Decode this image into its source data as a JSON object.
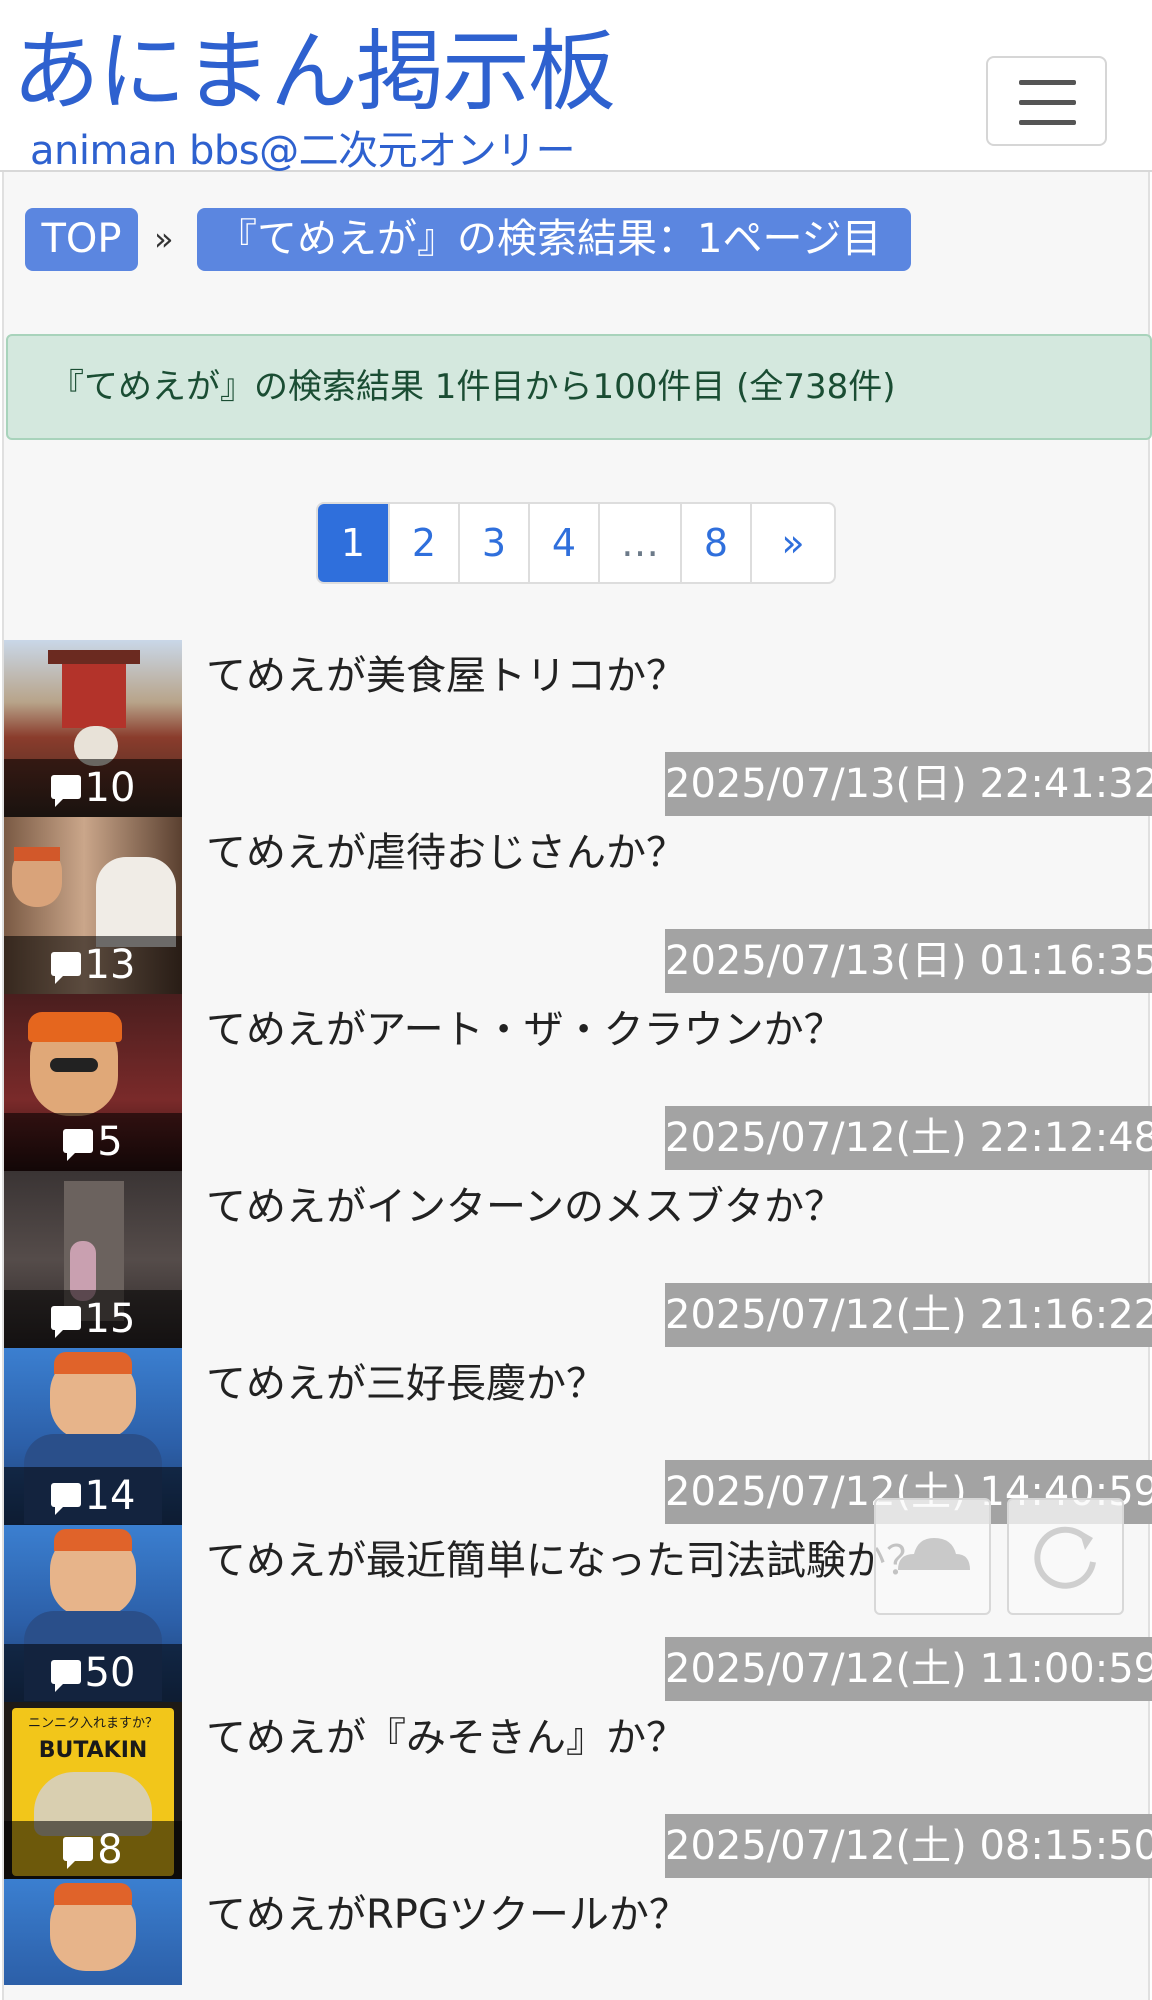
{
  "header": {
    "logo_main": "あにまん掲示板",
    "logo_sub": "animan bbs@二次元オンリー"
  },
  "breadcrumb": {
    "top_label": "TOP",
    "separator": "»",
    "current_label": "『てめえが』の検索結果：1ページ目"
  },
  "alert": {
    "text": "『てめえが』の検索結果 1件目から100件目 (全738件)"
  },
  "pagination": {
    "pages": [
      "1",
      "2",
      "3",
      "4",
      "…",
      "8",
      "»"
    ],
    "active": "1"
  },
  "threads": [
    {
      "title": "てめえが美食屋トリコか？",
      "count": "10",
      "date": "2025/07/13(日) 22:41:32"
    },
    {
      "title": "てめえが虐待おじさんか？",
      "count": "13",
      "date": "2025/07/13(日) 01:16:35"
    },
    {
      "title": "てめえがアート・ザ・クラウンか？",
      "count": "5",
      "date": "2025/07/12(土) 22:12:48"
    },
    {
      "title": "てめえがインターンのメスブタか？",
      "count": "15",
      "date": "2025/07/12(土) 21:16:22"
    },
    {
      "title": "てめえが三好長慶か？",
      "count": "14",
      "date": "2025/07/12(土) 14:40:59"
    },
    {
      "title": "てめえが最近簡単になった司法試験か？",
      "count": "50",
      "date": "2025/07/12(土) 11:00:59"
    },
    {
      "title": "てめえが『みそきん』か？",
      "count": "8",
      "date": "2025/07/12(土) 08:15:50"
    },
    {
      "title": "てめえがRPGツクールか？",
      "count": "",
      "date": ""
    }
  ],
  "thumb_text": {
    "butakin_top": "ニンニク入れますか？",
    "butakin_brand": "BUTAKIN"
  },
  "colors": {
    "accent": "#2e61cf",
    "crumb": "#5b86e0",
    "alert_bg": "#d4e8de",
    "date_bg": "#a3a3a3"
  },
  "icons": {
    "menu": "hamburger-icon",
    "comment": "speech-bubble-icon",
    "scroll_top": "cloud-up-icon",
    "reload": "reload-icon"
  }
}
